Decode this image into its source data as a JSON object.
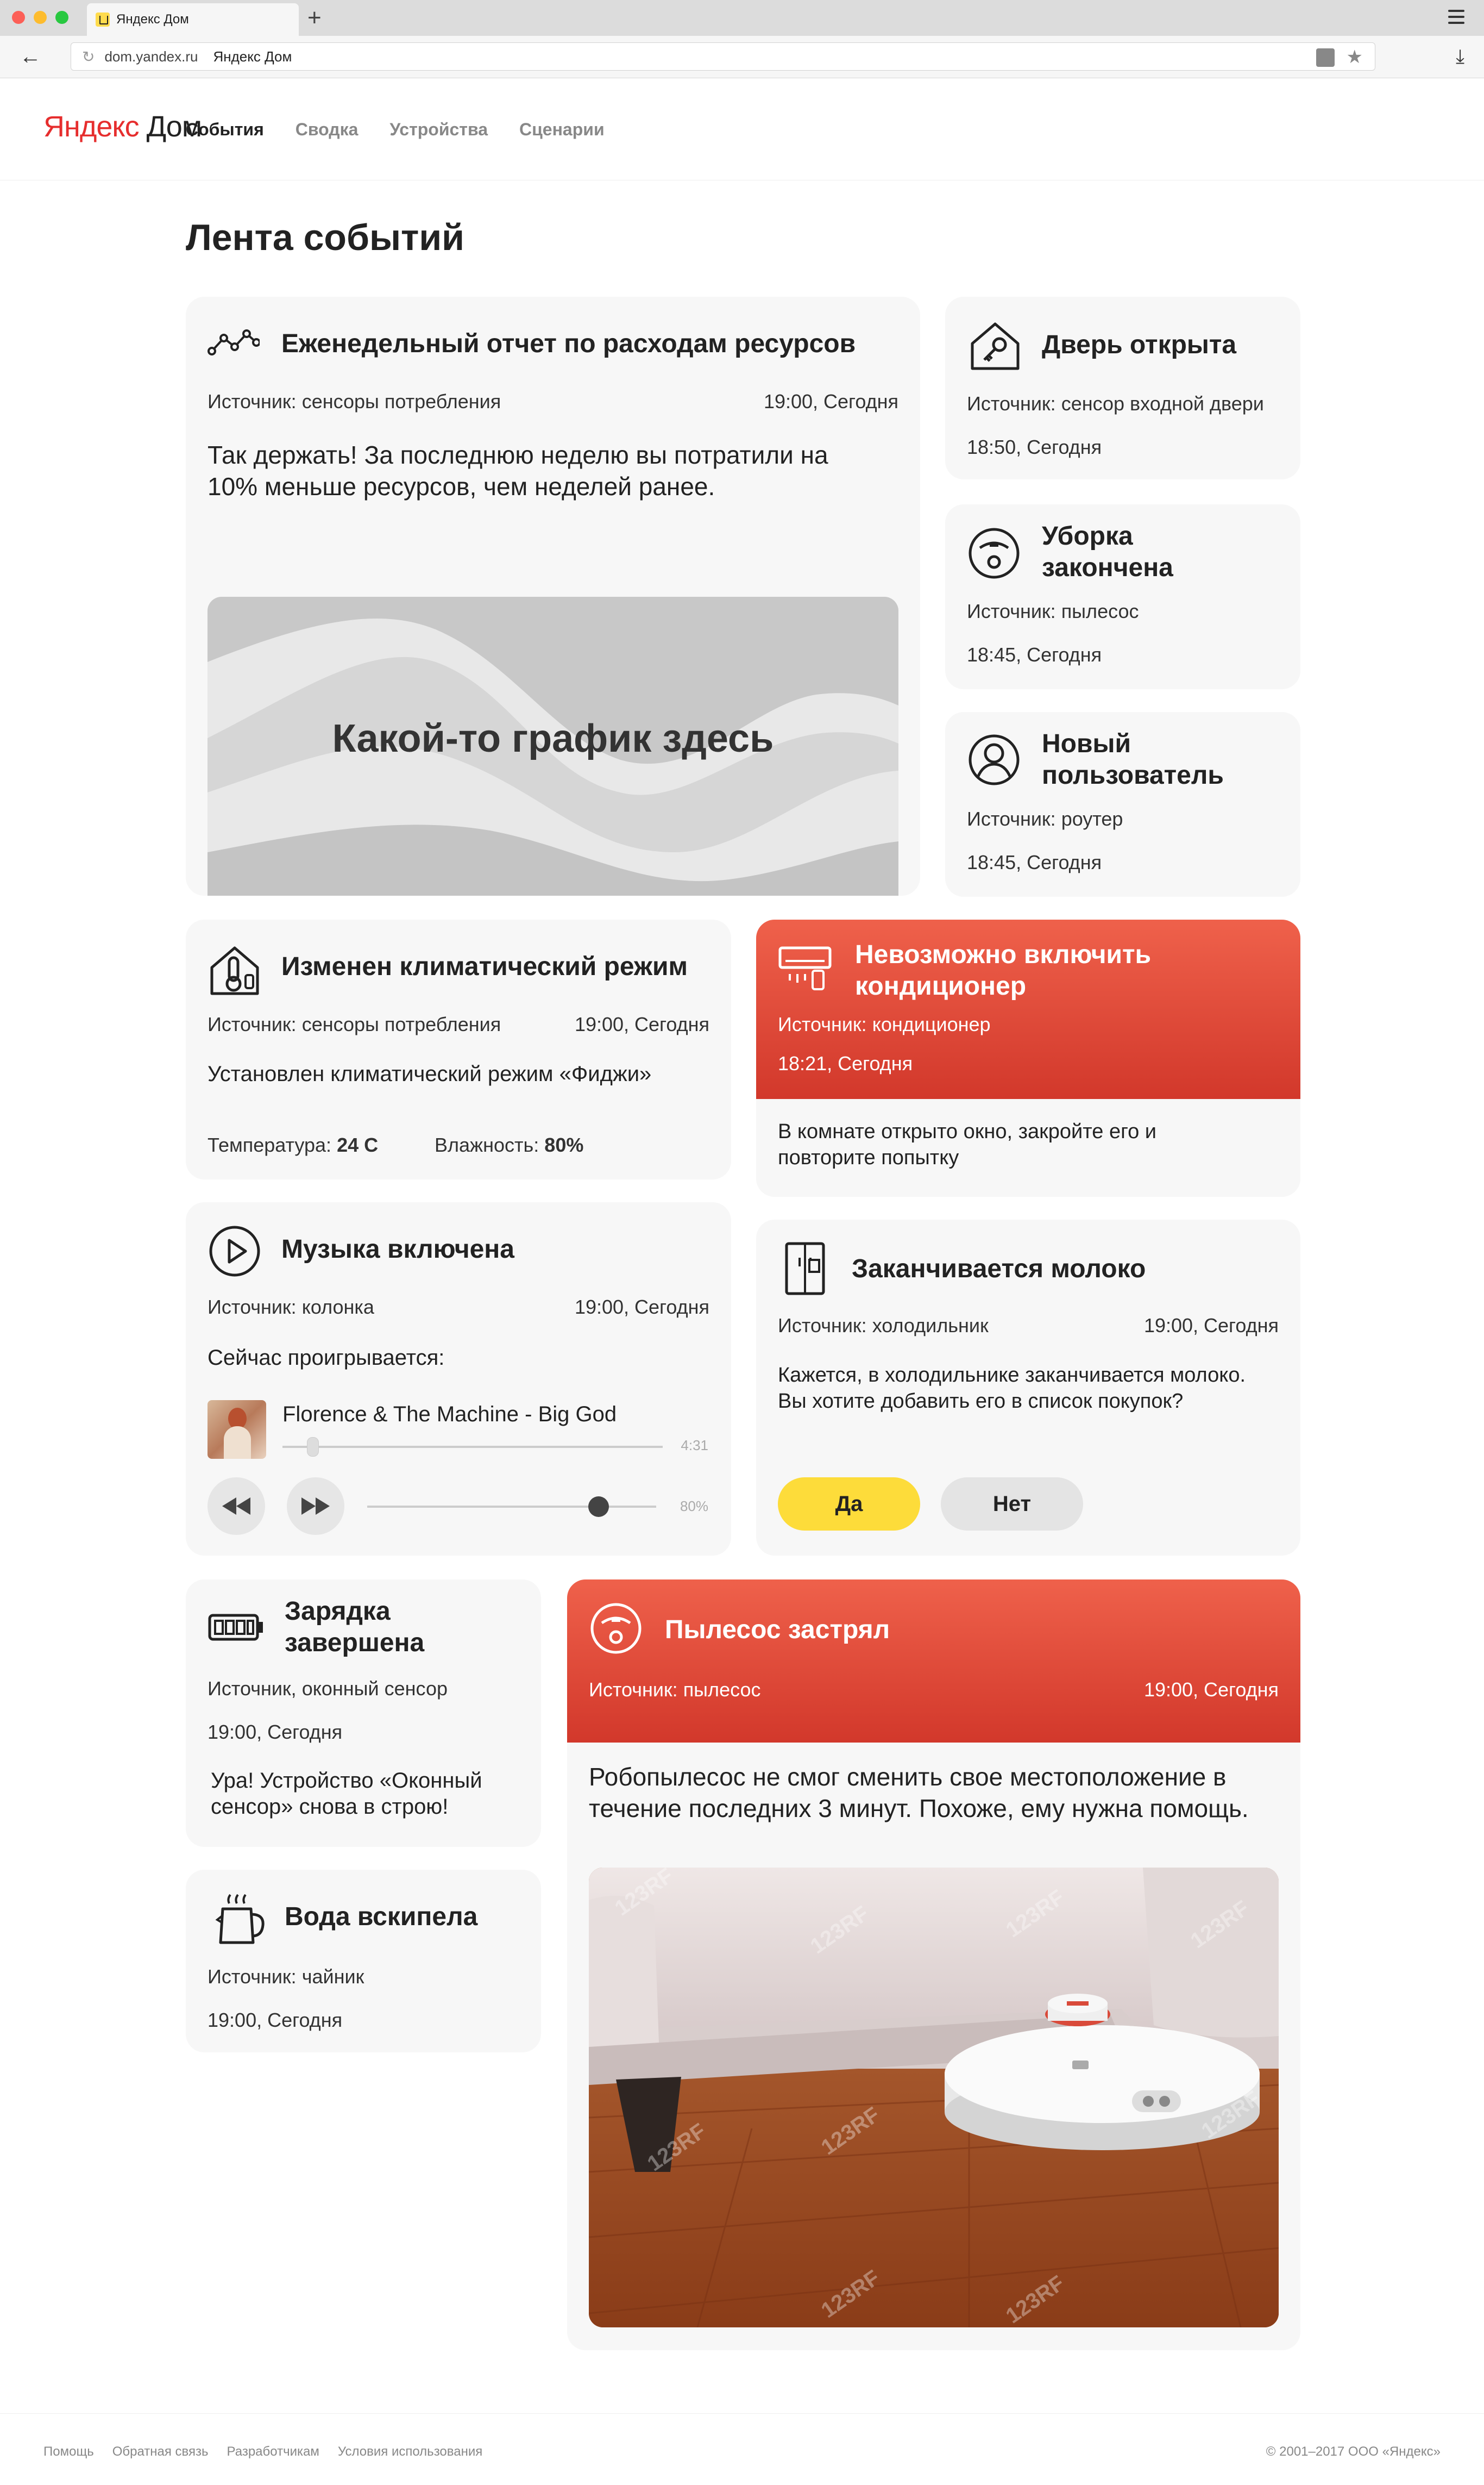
{
  "browser": {
    "tab_title": "Яндекс Дом",
    "url_host": "dom.yandex.ru",
    "url_title": "Яндекс Дом"
  },
  "header": {
    "logo_brand": "Яндекс",
    "logo_product": "Дом",
    "nav": [
      "События",
      "Сводка",
      "Устройства",
      "Сценарии"
    ],
    "active_nav": "События"
  },
  "page_title": "Лента событий",
  "cards": {
    "weekly": {
      "title": "Еженедельный отчет по расходам ресурсов",
      "source": "Источник: сенсоры потребления",
      "time": "19:00, Сегодня",
      "text": "Так держать! За последнюю неделю вы потратили на 10% меньше ресурсов, чем неделей ранее.",
      "chart_label": "Какой-то график здесь"
    },
    "door": {
      "title": "Дверь открыта",
      "source": "Источник: сенсор входной двери",
      "time": "18:50, Сегодня"
    },
    "cleaning": {
      "title": "Уборка закончена",
      "source": "Источник: пылесос",
      "time": "18:45, Сегодня"
    },
    "newuser": {
      "title": "Новый пользователь",
      "source": "Источник: роутер",
      "time": "18:45, Сегодня"
    },
    "climate": {
      "title": "Изменен климатический режим",
      "source": "Источник: сенсоры потребления",
      "time": "19:00, Сегодня",
      "text": "Установлен климатический режим «Фиджи»",
      "temp_label": "Температура:",
      "temp_value": "24 C",
      "hum_label": "Влажность:",
      "hum_value": "80%"
    },
    "ac": {
      "title": "Невозможно включить кондиционер",
      "source": "Источник: кондиционер",
      "time": "18:21, Сегодня",
      "text": "В комнате открыто окно, закройте его и повторите попытку"
    },
    "music": {
      "title": "Музыка включена",
      "source": "Источник: колонка",
      "time": "19:00, Сегодня",
      "now_playing": "Сейчас проигрывается:",
      "track": "Florence & The Machine - Big God",
      "duration": "4:31",
      "progress": 0.08,
      "volume_label": "80%",
      "volume": 0.8
    },
    "milk": {
      "title": "Заканчивается молоко",
      "source": "Источник: холодильник",
      "time": "19:00, Сегодня",
      "text": "Кажется, в холодильнике заканчивается молоко. Вы хотите добавить его в список покупок?",
      "yes": "Да",
      "no": "Нет"
    },
    "charging": {
      "title": "Зарядка завершена",
      "source": "Источник, оконный сенсор",
      "time": "19:00, Сегодня",
      "text": "Ура! Устройство «Оконный сенсор» снова в строю!"
    },
    "kettle": {
      "title": "Вода вскипела",
      "source": "Источник: чайник",
      "time": "19:00, Сегодня"
    },
    "vacuum": {
      "title": "Пылесос застрял",
      "source": "Источник: пылесос",
      "time": "19:00, Сегодня",
      "text": "Робопылесос не смог сменить свое местоположение в течение последних 3 минут. Похоже, ему нужна помощь.",
      "watermark": "123RF"
    }
  },
  "footer": {
    "links": [
      "Помощь",
      "Обратная связь",
      "Разработчикам",
      "Условия использования"
    ],
    "copyright": "© 2001–2017 ООО «Яндекс»"
  },
  "colors": {
    "accent_yellow": "#ffdb4d",
    "alert_red": "#e34a38",
    "card_bg": "#f7f7f7"
  }
}
